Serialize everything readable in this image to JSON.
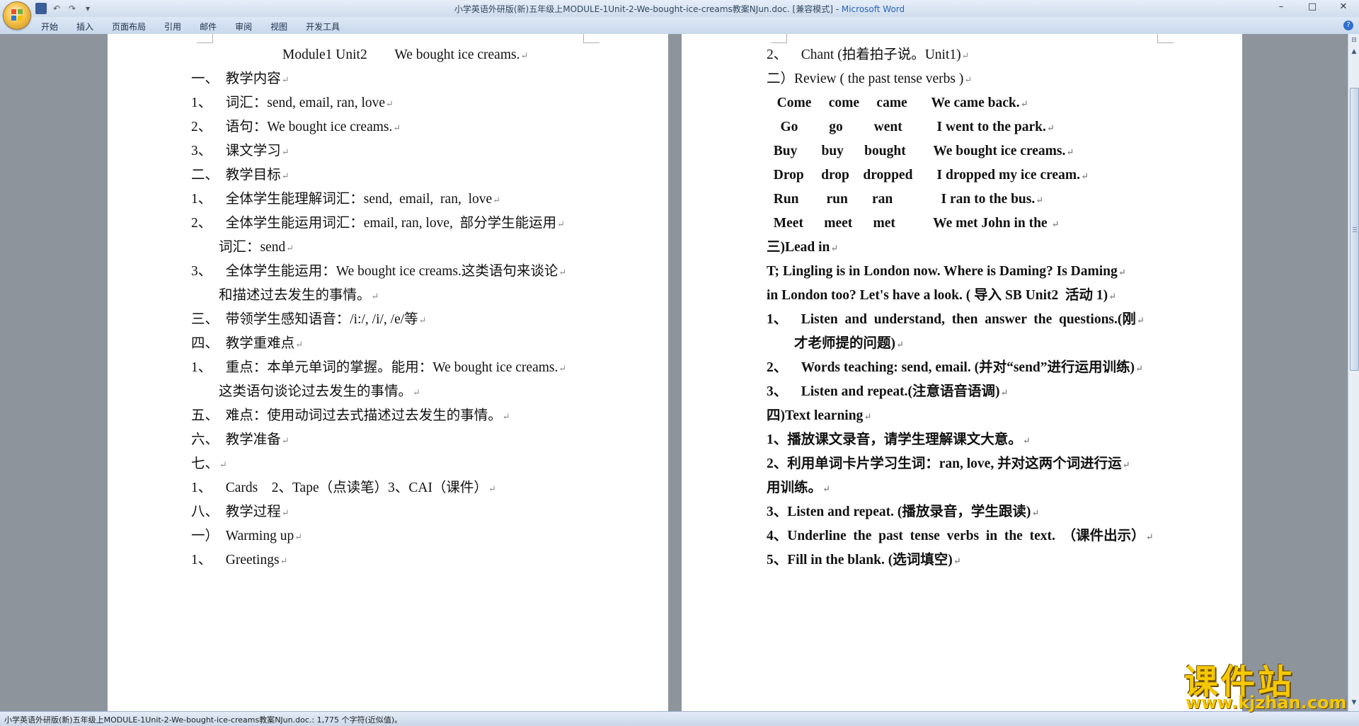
{
  "window": {
    "title": "小学英语外研版(新)五年级上MODULE-1Unit-2-We-bought-ice-creams教案NJun.doc. [兼容模式] - ",
    "app_name": "Microsoft Word",
    "minimize": "–",
    "maximize": "□",
    "close": "✕"
  },
  "ribbon": {
    "tabs": [
      "开始",
      "插入",
      "页面布局",
      "引用",
      "邮件",
      "审阅",
      "视图",
      "开发工具"
    ],
    "help": "?"
  },
  "page_left": {
    "lines": [
      "Module1 Unit2        We bought ice creams.",
      "一、  教学内容",
      "1、    词汇：send, email, ran, love",
      "2、    语句：We bought ice creams.",
      "3、    课文学习",
      "二、  教学目标",
      "1、    全体学生能理解词汇：send,  email,  ran,  love",
      "2、    全体学生能运用词汇：email, ran, love,  部分学生能运用",
      "        词汇：send",
      "3、    全体学生能运用：We bought ice creams.这类语句来谈论",
      "        和描述过去发生的事情。",
      "三、  带领学生感知语音：/i:/, /i/, /e/等",
      "四、  教学重难点",
      "1、    重点：本单元单词的掌握。能用：We bought ice creams.",
      "        这类语句谈论过去发生的事情。",
      "五、  难点：使用动词过去式描述过去发生的事情。",
      "六、  教学准备",
      "七、",
      "1、    Cards    2、Tape（点读笔）3、CAI（课件）",
      "八、  教学过程",
      "一）  Warming up",
      "1、    Greetings"
    ]
  },
  "page_right": {
    "lines": [
      "2、    Chant (拍着拍子说。Unit1)",
      "二）Review ( the past tense verbs )",
      "   Come     come     came       We came back.",
      "    Go         go         went          I went to the park.",
      "  Buy       buy      bought        We bought ice creams.",
      "  Drop     drop    dropped       I dropped my ice cream.",
      "  Run        run       ran              I ran to the bus.",
      "  Meet      meet      met           We met John in the ",
      "三)Lead in",
      "T; Lingling is in London now. Where is Daming? Is Daming",
      "in London too? Let's have a look. ( 导入 SB Unit2  活动 1)",
      "1、    Listen  and  understand,  then  answer  the  questions.(刚",
      "        才老师提的问题)",
      "2、    Words teaching: send, email. (并对“send”进行运用训练)",
      "3、    Listen and repeat.(注意语音语调)",
      "四)Text learning",
      "1、播放课文录音，请学生理解课文大意。",
      "2、利用单词卡片学习生词：ran, love, 并对这两个词进行运",
      "用训练。",
      "3、Listen and repeat. (播放录音，学生跟读)",
      "4、Underline  the  past  tense  verbs  in  the  text.  （课件出示）",
      "5、Fill in the blank. (选词填空)"
    ]
  },
  "status_bar": {
    "text": "小学英语外研版(新)五年级上MODULE-1Unit-2-We-bought-ice-creams教案NJun.doc.: 1,775 个字符(近似值)。"
  },
  "watermark": {
    "text": "课件站",
    "url": "www.kjzhan.com"
  },
  "scrollbar": {
    "up": "▲",
    "down": "▼"
  },
  "icons": {
    "office_button": "office-logo-icon",
    "save": "save-icon",
    "undo": "undo-icon",
    "redo": "redo-icon",
    "paragraph_mark": "↵"
  },
  "colors": {
    "title_app": "#2966b8",
    "watermark": "#f5c800"
  }
}
